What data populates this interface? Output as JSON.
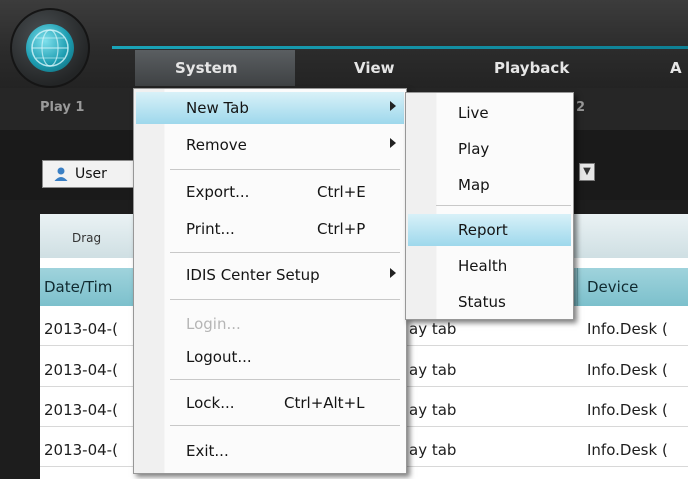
{
  "menubar": {
    "items": [
      {
        "label": "System"
      },
      {
        "label": "View"
      },
      {
        "label": "Playback"
      },
      {
        "label": "A"
      }
    ]
  },
  "tabs": {
    "play1": "Play 1",
    "play2_fragment": "2"
  },
  "toolbar": {
    "user_label": "User"
  },
  "grid": {
    "drag_hint": "Drag",
    "columns": {
      "date": "Date/Tim",
      "device": "Device"
    },
    "rows": [
      {
        "date": "2013-04-(",
        "action": "ay tab",
        "device": "Info.Desk ("
      },
      {
        "date": "2013-04-(",
        "action": "ay tab",
        "device": "Info.Desk ("
      },
      {
        "date": "2013-04-(",
        "action": "ay tab",
        "device": "Info.Desk ("
      },
      {
        "date": "2013-04-(",
        "action": "ay tab",
        "device": "Info.Desk ("
      }
    ]
  },
  "system_menu": {
    "new_tab": "New Tab",
    "remove": "Remove",
    "export": "Export...",
    "export_shortcut": "Ctrl+E",
    "print": "Print...",
    "print_shortcut": "Ctrl+P",
    "center_setup": "IDIS Center Setup",
    "login": "Login...",
    "logout": "Logout...",
    "lock": "Lock...",
    "lock_shortcut": "Ctrl+Alt+L",
    "exit": "Exit..."
  },
  "new_tab_submenu": {
    "items": [
      "Live",
      "Play",
      "Map",
      "Report",
      "Health",
      "Status"
    ],
    "highlighted": "Report"
  },
  "colors": {
    "accent": "#1aa4b8",
    "highlight": "#9ed8ec",
    "header": "#7cc0cc"
  }
}
